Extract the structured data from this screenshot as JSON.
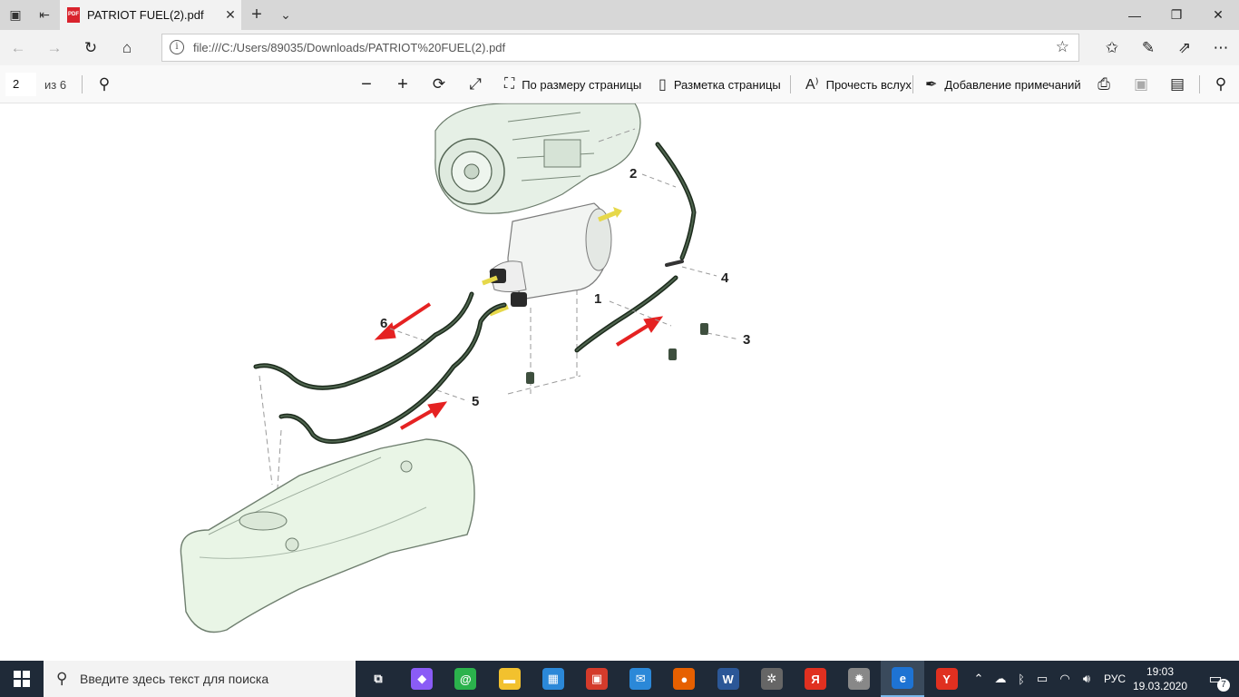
{
  "tab": {
    "title": "PATRIOT FUEL(2).pdf",
    "pdf_badge": "PDF"
  },
  "address": {
    "url": "file:///C:/Users/89035/Downloads/PATRIOT%20FUEL(2).pdf"
  },
  "pdf_toolbar": {
    "page_current": "2",
    "page_total": "из 6",
    "fit_page_label": "По размеру страницы",
    "page_layout_label": "Разметка страницы",
    "read_aloud_label": "Прочесть вслух",
    "add_notes_label": "Добавление примечаний"
  },
  "diagram": {
    "callouts": [
      "1",
      "2",
      "3",
      "4",
      "5",
      "6"
    ]
  },
  "taskbar": {
    "search_placeholder": "Введите здесь текст для поиска",
    "language": "РУС",
    "time": "19:03",
    "date": "19.03.2020",
    "notification_count": "7",
    "apps": [
      {
        "name": "task-view",
        "letter": "⧉",
        "color": "#1f2a38"
      },
      {
        "name": "alice",
        "letter": "◆",
        "color": "#8a5cf6"
      },
      {
        "name": "agent",
        "letter": "@",
        "color": "#2bb24c"
      },
      {
        "name": "file-explorer",
        "letter": "▬",
        "color": "#f2c12e"
      },
      {
        "name": "store",
        "letter": "▦",
        "color": "#2b88d8"
      },
      {
        "name": "gift",
        "letter": "▣",
        "color": "#d43b2b"
      },
      {
        "name": "mail",
        "letter": "✉",
        "color": "#2b88d8"
      },
      {
        "name": "firefox",
        "letter": "●",
        "color": "#e66000"
      },
      {
        "name": "word",
        "letter": "W",
        "color": "#2b5797"
      },
      {
        "name": "video",
        "letter": "✲",
        "color": "#666666"
      },
      {
        "name": "yandex-browser-2",
        "letter": "Я",
        "color": "#e03020"
      },
      {
        "name": "plugin",
        "letter": "✹",
        "color": "#888888"
      },
      {
        "name": "edge",
        "letter": "e",
        "color": "#1e73d3"
      },
      {
        "name": "yandex-browser",
        "letter": "Y",
        "color": "#e03020"
      }
    ]
  }
}
